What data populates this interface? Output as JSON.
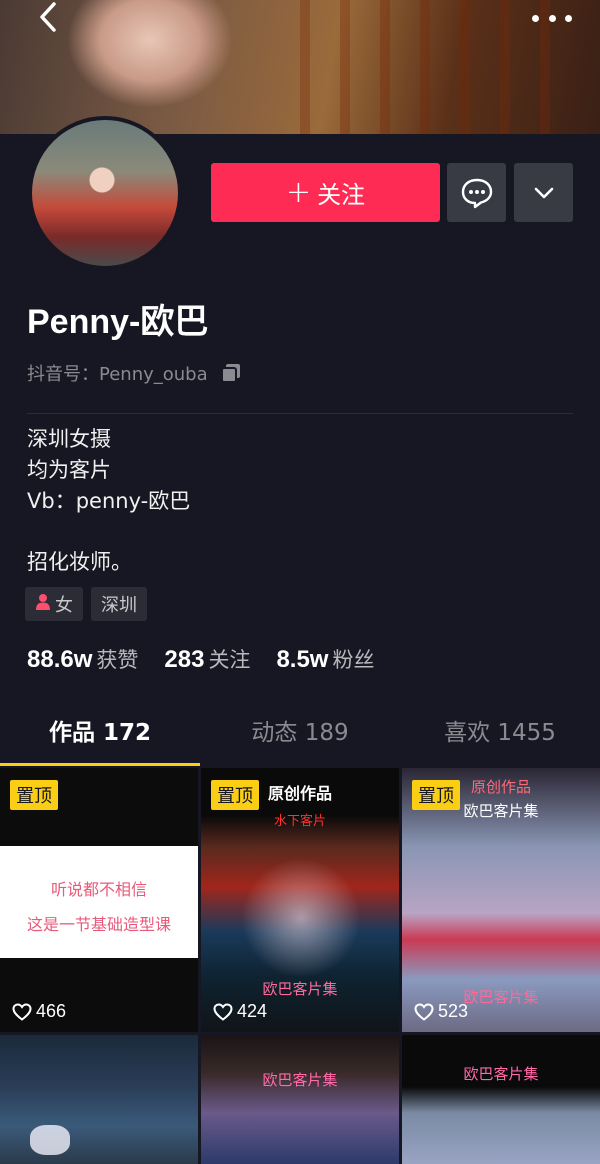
{
  "header": {
    "back_icon": "chevron-left-icon",
    "more_icon": "ellipsis-icon"
  },
  "profile": {
    "name": "Penny-欧巴",
    "id_label": "抖音号：Penny_ouba",
    "bio_lines": [
      "深圳女摄",
      "均为客片",
      "Vb：penny-欧巴"
    ],
    "bio_extra": "招化妆师。",
    "tags": [
      {
        "icon": "female-icon",
        "label": "女"
      },
      {
        "label": "深圳"
      }
    ]
  },
  "actions": {
    "follow_label": "关注",
    "follow_plus": "+",
    "follow_color": "#fe2c55"
  },
  "stats": [
    {
      "num": "88.6w",
      "label": "获赞"
    },
    {
      "num": "283",
      "label": "关注"
    },
    {
      "num": "8.5w",
      "label": "粉丝"
    }
  ],
  "tabs": [
    {
      "label": "作品 172"
    },
    {
      "label": "动态 189"
    },
    {
      "label": "喜欢 1455"
    }
  ],
  "accent": "#face15",
  "videos": [
    {
      "pinned": "置顶",
      "likes": "466",
      "lines": [
        "听说都不相信",
        "这是一节基础造型课"
      ]
    },
    {
      "pinned": "置顶",
      "likes": "424",
      "lines": [
        "原创作品",
        "水下客片",
        "欧巴客片集"
      ]
    },
    {
      "pinned": "置顶",
      "likes": "523",
      "lines": [
        "原创作品",
        "欧巴客片集",
        "欧巴客片集"
      ]
    },
    {
      "lines": []
    },
    {
      "lines": [
        "欧巴客片集"
      ]
    },
    {
      "lines": [
        "欧巴客片集"
      ]
    }
  ]
}
